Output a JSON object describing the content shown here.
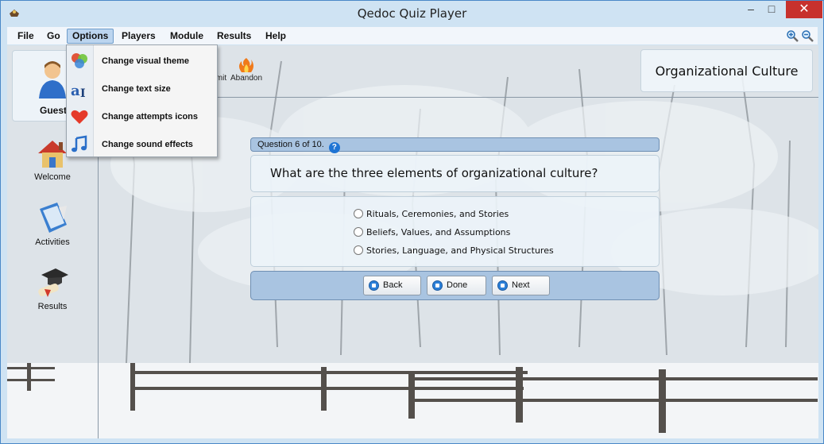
{
  "window": {
    "title": "Qedoc Quiz Player"
  },
  "menu": [
    "File",
    "Go",
    "Options",
    "Players",
    "Module",
    "Results",
    "Help"
  ],
  "options_menu": [
    {
      "label": "Change visual theme",
      "icon": "theme-icon"
    },
    {
      "label": "Change text size",
      "icon": "text-size-icon"
    },
    {
      "label": "Change attempts icons",
      "icon": "heart-icon"
    },
    {
      "label": "Change sound effects",
      "icon": "music-note-icon"
    }
  ],
  "user": {
    "name": "Guest"
  },
  "sidebar": [
    {
      "label": "Welcome",
      "icon": "house-icon"
    },
    {
      "label": "Activities",
      "icon": "book-icon"
    },
    {
      "label": "Results",
      "icon": "graduation-cap-icon"
    }
  ],
  "toolbar": {
    "submit": "Submit",
    "abandon": "Abandon"
  },
  "module_title": "Organizational Culture",
  "quiz": {
    "progress": "Question 6 of 10.",
    "question": "What are the three elements of organizational culture?",
    "answers": [
      "Rituals, Ceremonies, and Stories",
      "Beliefs, Values, and Assumptions",
      "Stories, Language, and Physical Structures"
    ],
    "buttons": {
      "back": "Back",
      "done": "Done",
      "next": "Next"
    }
  },
  "colors": {
    "accent": "#a9c4e1",
    "close_button": "#c7312d"
  }
}
